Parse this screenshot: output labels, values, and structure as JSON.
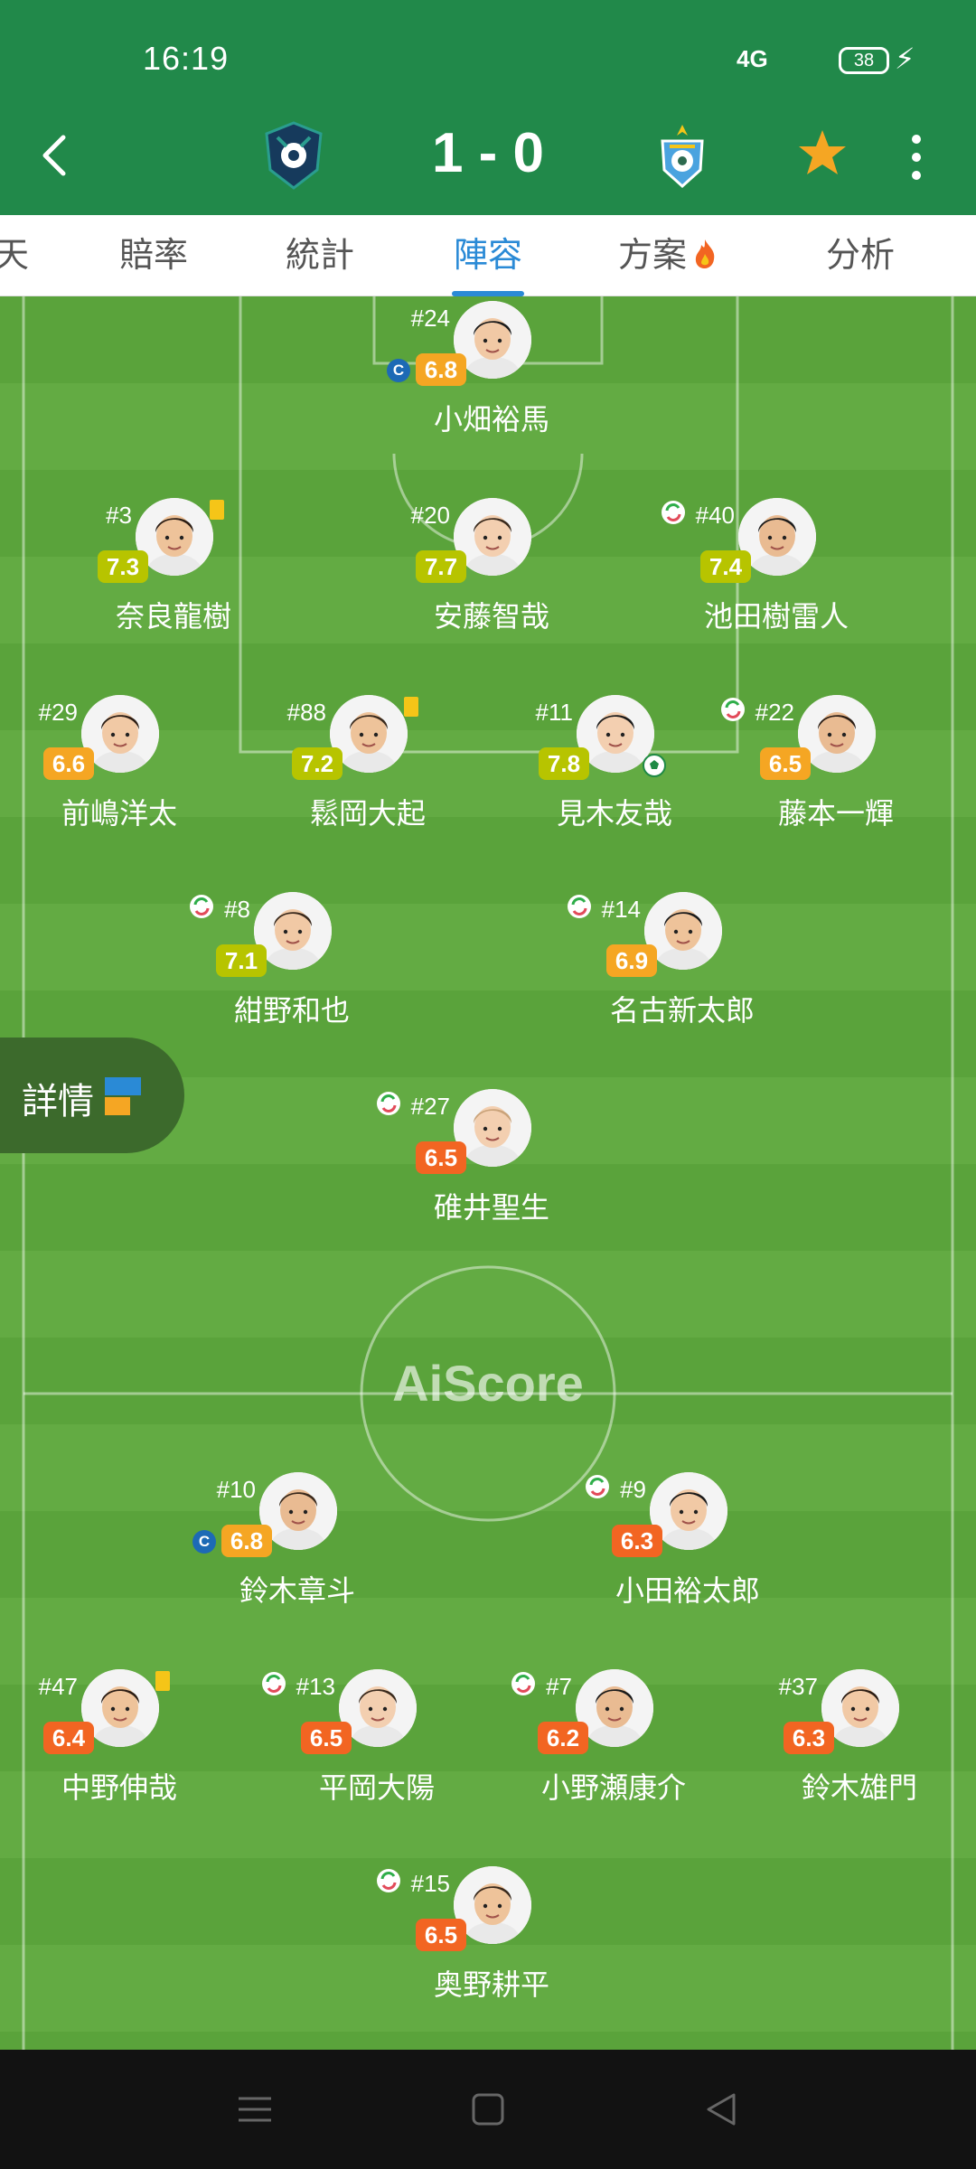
{
  "status_bar": {
    "time": "16:19",
    "network": "4G",
    "battery": "38"
  },
  "header": {
    "score": "1 - 0"
  },
  "tabs": [
    {
      "label": "天",
      "active": false
    },
    {
      "label": "賠率",
      "active": false
    },
    {
      "label": "統計",
      "active": false
    },
    {
      "label": "陣容",
      "active": true
    },
    {
      "label": "方案",
      "active": false
    },
    {
      "label": "分析",
      "active": false
    }
  ],
  "pitch": {
    "watermark": "AiScore"
  },
  "details_button": {
    "label": "詳情"
  },
  "players": [
    {
      "team": "home",
      "number": "#24",
      "name": "小畑裕馬",
      "rating": "6.8",
      "rating_color": "#f5a623",
      "captain": true,
      "yellow_card": false,
      "sub": false,
      "goal": false
    },
    {
      "team": "home",
      "number": "#3",
      "name": "奈良龍樹",
      "rating": "7.3",
      "rating_color": "#b7c400",
      "captain": false,
      "yellow_card": true,
      "sub": false,
      "goal": false
    },
    {
      "team": "home",
      "number": "#20",
      "name": "安藤智哉",
      "rating": "7.7",
      "rating_color": "#b7c400",
      "captain": false,
      "yellow_card": false,
      "sub": false,
      "goal": false
    },
    {
      "team": "home",
      "number": "#40",
      "name": "池田樹雷人",
      "rating": "7.4",
      "rating_color": "#b7c400",
      "captain": false,
      "yellow_card": false,
      "sub": true,
      "goal": false
    },
    {
      "team": "home",
      "number": "#29",
      "name": "前嶋洋太",
      "rating": "6.6",
      "rating_color": "#f5a623",
      "captain": false,
      "yellow_card": false,
      "sub": false,
      "goal": false
    },
    {
      "team": "home",
      "number": "#88",
      "name": "鬆岡大起",
      "rating": "7.2",
      "rating_color": "#b7c400",
      "captain": false,
      "yellow_card": true,
      "sub": false,
      "goal": false
    },
    {
      "team": "home",
      "number": "#11",
      "name": "見木友哉",
      "rating": "7.8",
      "rating_color": "#b7c400",
      "captain": false,
      "yellow_card": false,
      "sub": false,
      "goal": true
    },
    {
      "team": "home",
      "number": "#22",
      "name": "藤本一輝",
      "rating": "6.5",
      "rating_color": "#f5a623",
      "captain": false,
      "yellow_card": false,
      "sub": true,
      "goal": false
    },
    {
      "team": "home",
      "number": "#8",
      "name": "紺野和也",
      "rating": "7.1",
      "rating_color": "#b7c400",
      "captain": false,
      "yellow_card": false,
      "sub": true,
      "goal": false
    },
    {
      "team": "home",
      "number": "#14",
      "name": "名古新太郎",
      "rating": "6.9",
      "rating_color": "#f5a623",
      "captain": false,
      "yellow_card": false,
      "sub": true,
      "goal": false
    },
    {
      "team": "home",
      "number": "#27",
      "name": "碓井聖生",
      "rating": "6.5",
      "rating_color": "#f26522",
      "captain": false,
      "yellow_card": false,
      "sub": true,
      "goal": false
    },
    {
      "team": "away",
      "number": "#10",
      "name": "鈴木章斗",
      "rating": "6.8",
      "rating_color": "#f5a623",
      "captain": true,
      "yellow_card": false,
      "sub": false,
      "goal": false
    },
    {
      "team": "away",
      "number": "#9",
      "name": "小田裕太郎",
      "rating": "6.3",
      "rating_color": "#f26522",
      "captain": false,
      "yellow_card": false,
      "sub": true,
      "goal": false
    },
    {
      "team": "away",
      "number": "#47",
      "name": "中野伸哉",
      "rating": "6.4",
      "rating_color": "#f26522",
      "captain": false,
      "yellow_card": true,
      "sub": false,
      "goal": false
    },
    {
      "team": "away",
      "number": "#13",
      "name": "平岡大陽",
      "rating": "6.5",
      "rating_color": "#f26522",
      "captain": false,
      "yellow_card": false,
      "sub": true,
      "goal": false
    },
    {
      "team": "away",
      "number": "#7",
      "name": "小野瀬康介",
      "rating": "6.2",
      "rating_color": "#f26522",
      "captain": false,
      "yellow_card": false,
      "sub": true,
      "goal": false
    },
    {
      "team": "away",
      "number": "#37",
      "name": "鈴木雄門",
      "rating": "6.3",
      "rating_color": "#f26522",
      "captain": false,
      "yellow_card": false,
      "sub": false,
      "goal": false
    },
    {
      "team": "away",
      "number": "#15",
      "name": "奥野耕平",
      "rating": "6.5",
      "rating_color": "#f26522",
      "captain": false,
      "yellow_card": false,
      "sub": true,
      "goal": false
    }
  ],
  "colors": {
    "header_green": "#21894a",
    "tab_active": "#2a8ad6",
    "captain_badge": "#1d6ab5"
  }
}
